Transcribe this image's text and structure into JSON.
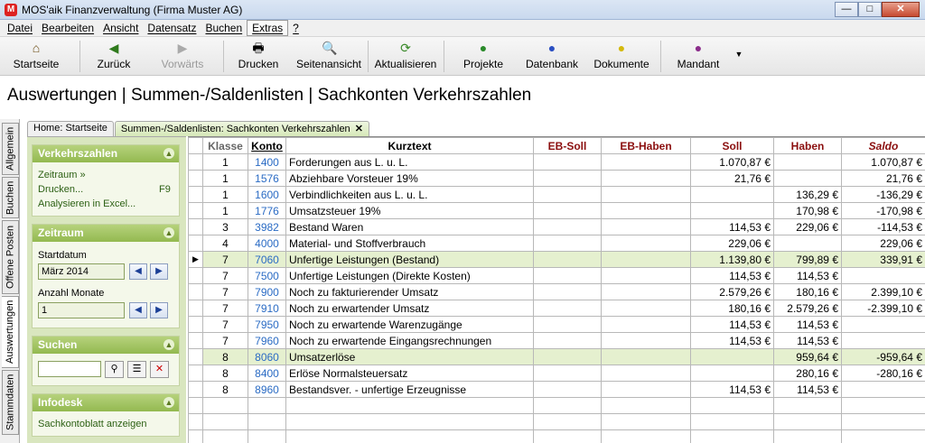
{
  "window": {
    "title": "MOS'aik Finanzverwaltung (Firma Muster AG)",
    "min": "—",
    "max": "□",
    "close": "✕"
  },
  "menu": [
    "Datei",
    "Bearbeiten",
    "Ansicht",
    "Datensatz",
    "Buchen",
    "Extras",
    "?"
  ],
  "toolbar": {
    "home": "Startseite",
    "back": "Zurück",
    "forward": "Vorwärts",
    "print": "Drucken",
    "preview": "Seitenansicht",
    "refresh": "Aktualisieren",
    "projects": "Projekte",
    "database": "Datenbank",
    "documents": "Dokumente",
    "client": "Mandant"
  },
  "heading": "Auswertungen | Summen-/Saldenlisten | Sachkonten Verkehrszahlen",
  "vtabs": [
    "Allgemein",
    "Buchen",
    "Offene Posten",
    "Auswertungen",
    "Stammdaten"
  ],
  "tabs": {
    "home": "Home: Startseite",
    "current": "Summen-/Saldenlisten: Sachkonten Verkehrszahlen",
    "close": "✕"
  },
  "side": {
    "verkehr": {
      "title": "Verkehrszahlen",
      "zeitraum": "Zeitraum »",
      "drucken": "Drucken...",
      "key": "F9",
      "excel": "Analysieren in Excel..."
    },
    "zeitraum": {
      "title": "Zeitraum",
      "start_label": "Startdatum",
      "start_value": "März 2014",
      "months_label": "Anzahl Monate",
      "months_value": "1"
    },
    "suchen": {
      "title": "Suchen",
      "value": ""
    },
    "infodesk": {
      "title": "Infodesk",
      "link": "Sachkontoblatt anzeigen"
    }
  },
  "grid": {
    "headers": [
      "Klasse",
      "Konto",
      "Kurztext",
      "EB-Soll",
      "EB-Haben",
      "Soll",
      "Haben",
      "Saldo"
    ],
    "rows": [
      {
        "klasse": "1",
        "konto": "1400",
        "text": "Forderungen aus L. u. L.",
        "ebsoll": "",
        "ebhaben": "",
        "soll": "1.070,87 €",
        "haben": "",
        "saldo": "1.070,87 €",
        "hl": false
      },
      {
        "klasse": "1",
        "konto": "1576",
        "text": "Abziehbare Vorsteuer 19%",
        "ebsoll": "",
        "ebhaben": "",
        "soll": "21,76 €",
        "haben": "",
        "saldo": "21,76 €",
        "hl": false
      },
      {
        "klasse": "1",
        "konto": "1600",
        "text": "Verbindlichkeiten aus L. u. L.",
        "ebsoll": "",
        "ebhaben": "",
        "soll": "",
        "haben": "136,29 €",
        "saldo": "-136,29 €",
        "hl": false
      },
      {
        "klasse": "1",
        "konto": "1776",
        "text": "Umsatzsteuer 19%",
        "ebsoll": "",
        "ebhaben": "",
        "soll": "",
        "haben": "170,98 €",
        "saldo": "-170,98 €",
        "hl": false
      },
      {
        "klasse": "3",
        "konto": "3982",
        "text": "Bestand Waren",
        "ebsoll": "",
        "ebhaben": "",
        "soll": "114,53 €",
        "haben": "229,06 €",
        "saldo": "-114,53 €",
        "hl": false
      },
      {
        "klasse": "4",
        "konto": "4000",
        "text": "Material- und Stoffverbrauch",
        "ebsoll": "",
        "ebhaben": "",
        "soll": "229,06 €",
        "haben": "",
        "saldo": "229,06 €",
        "hl": false
      },
      {
        "klasse": "7",
        "konto": "7060",
        "text": "Unfertige Leistungen (Bestand)",
        "ebsoll": "",
        "ebhaben": "",
        "soll": "1.139,80 €",
        "haben": "799,89 €",
        "saldo": "339,91 €",
        "hl": true,
        "selected": true
      },
      {
        "klasse": "7",
        "konto": "7500",
        "text": "Unfertige Leistungen (Direkte Kosten)",
        "ebsoll": "",
        "ebhaben": "",
        "soll": "114,53 €",
        "haben": "114,53 €",
        "saldo": "",
        "hl": false
      },
      {
        "klasse": "7",
        "konto": "7900",
        "text": "Noch zu fakturierender Umsatz",
        "ebsoll": "",
        "ebhaben": "",
        "soll": "2.579,26 €",
        "haben": "180,16 €",
        "saldo": "2.399,10 €",
        "hl": false
      },
      {
        "klasse": "7",
        "konto": "7910",
        "text": "Noch zu erwartender Umsatz",
        "ebsoll": "",
        "ebhaben": "",
        "soll": "180,16 €",
        "haben": "2.579,26 €",
        "saldo": "-2.399,10 €",
        "hl": false
      },
      {
        "klasse": "7",
        "konto": "7950",
        "text": "Noch zu erwartende Warenzugänge",
        "ebsoll": "",
        "ebhaben": "",
        "soll": "114,53 €",
        "haben": "114,53 €",
        "saldo": "",
        "hl": false
      },
      {
        "klasse": "7",
        "konto": "7960",
        "text": "Noch zu erwartende Eingangsrechnungen",
        "ebsoll": "",
        "ebhaben": "",
        "soll": "114,53 €",
        "haben": "114,53 €",
        "saldo": "",
        "hl": false
      },
      {
        "klasse": "8",
        "konto": "8060",
        "text": "Umsatzerlöse",
        "ebsoll": "",
        "ebhaben": "",
        "soll": "",
        "haben": "959,64 €",
        "saldo": "-959,64 €",
        "hl": true
      },
      {
        "klasse": "8",
        "konto": "8400",
        "text": "Erlöse Normalsteuersatz",
        "ebsoll": "",
        "ebhaben": "",
        "soll": "",
        "haben": "280,16 €",
        "saldo": "-280,16 €",
        "hl": false
      },
      {
        "klasse": "8",
        "konto": "8960",
        "text": "Bestandsver. - unfertige Erzeugnisse",
        "ebsoll": "",
        "ebhaben": "",
        "soll": "114,53 €",
        "haben": "114,53 €",
        "saldo": "",
        "hl": false
      }
    ],
    "empty_rows": 4
  }
}
